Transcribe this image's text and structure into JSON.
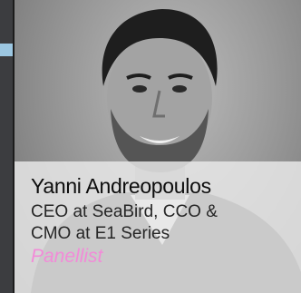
{
  "speaker": {
    "name": "Yanni Andreopoulos",
    "role_line1": "CEO at SeaBird, CCO &",
    "role_line2": "CMO at E1 Series",
    "tag": "Panellist"
  },
  "colors": {
    "accent": "#9cc7e2",
    "tag": "#f28bd8",
    "background": "#3c3d40"
  }
}
